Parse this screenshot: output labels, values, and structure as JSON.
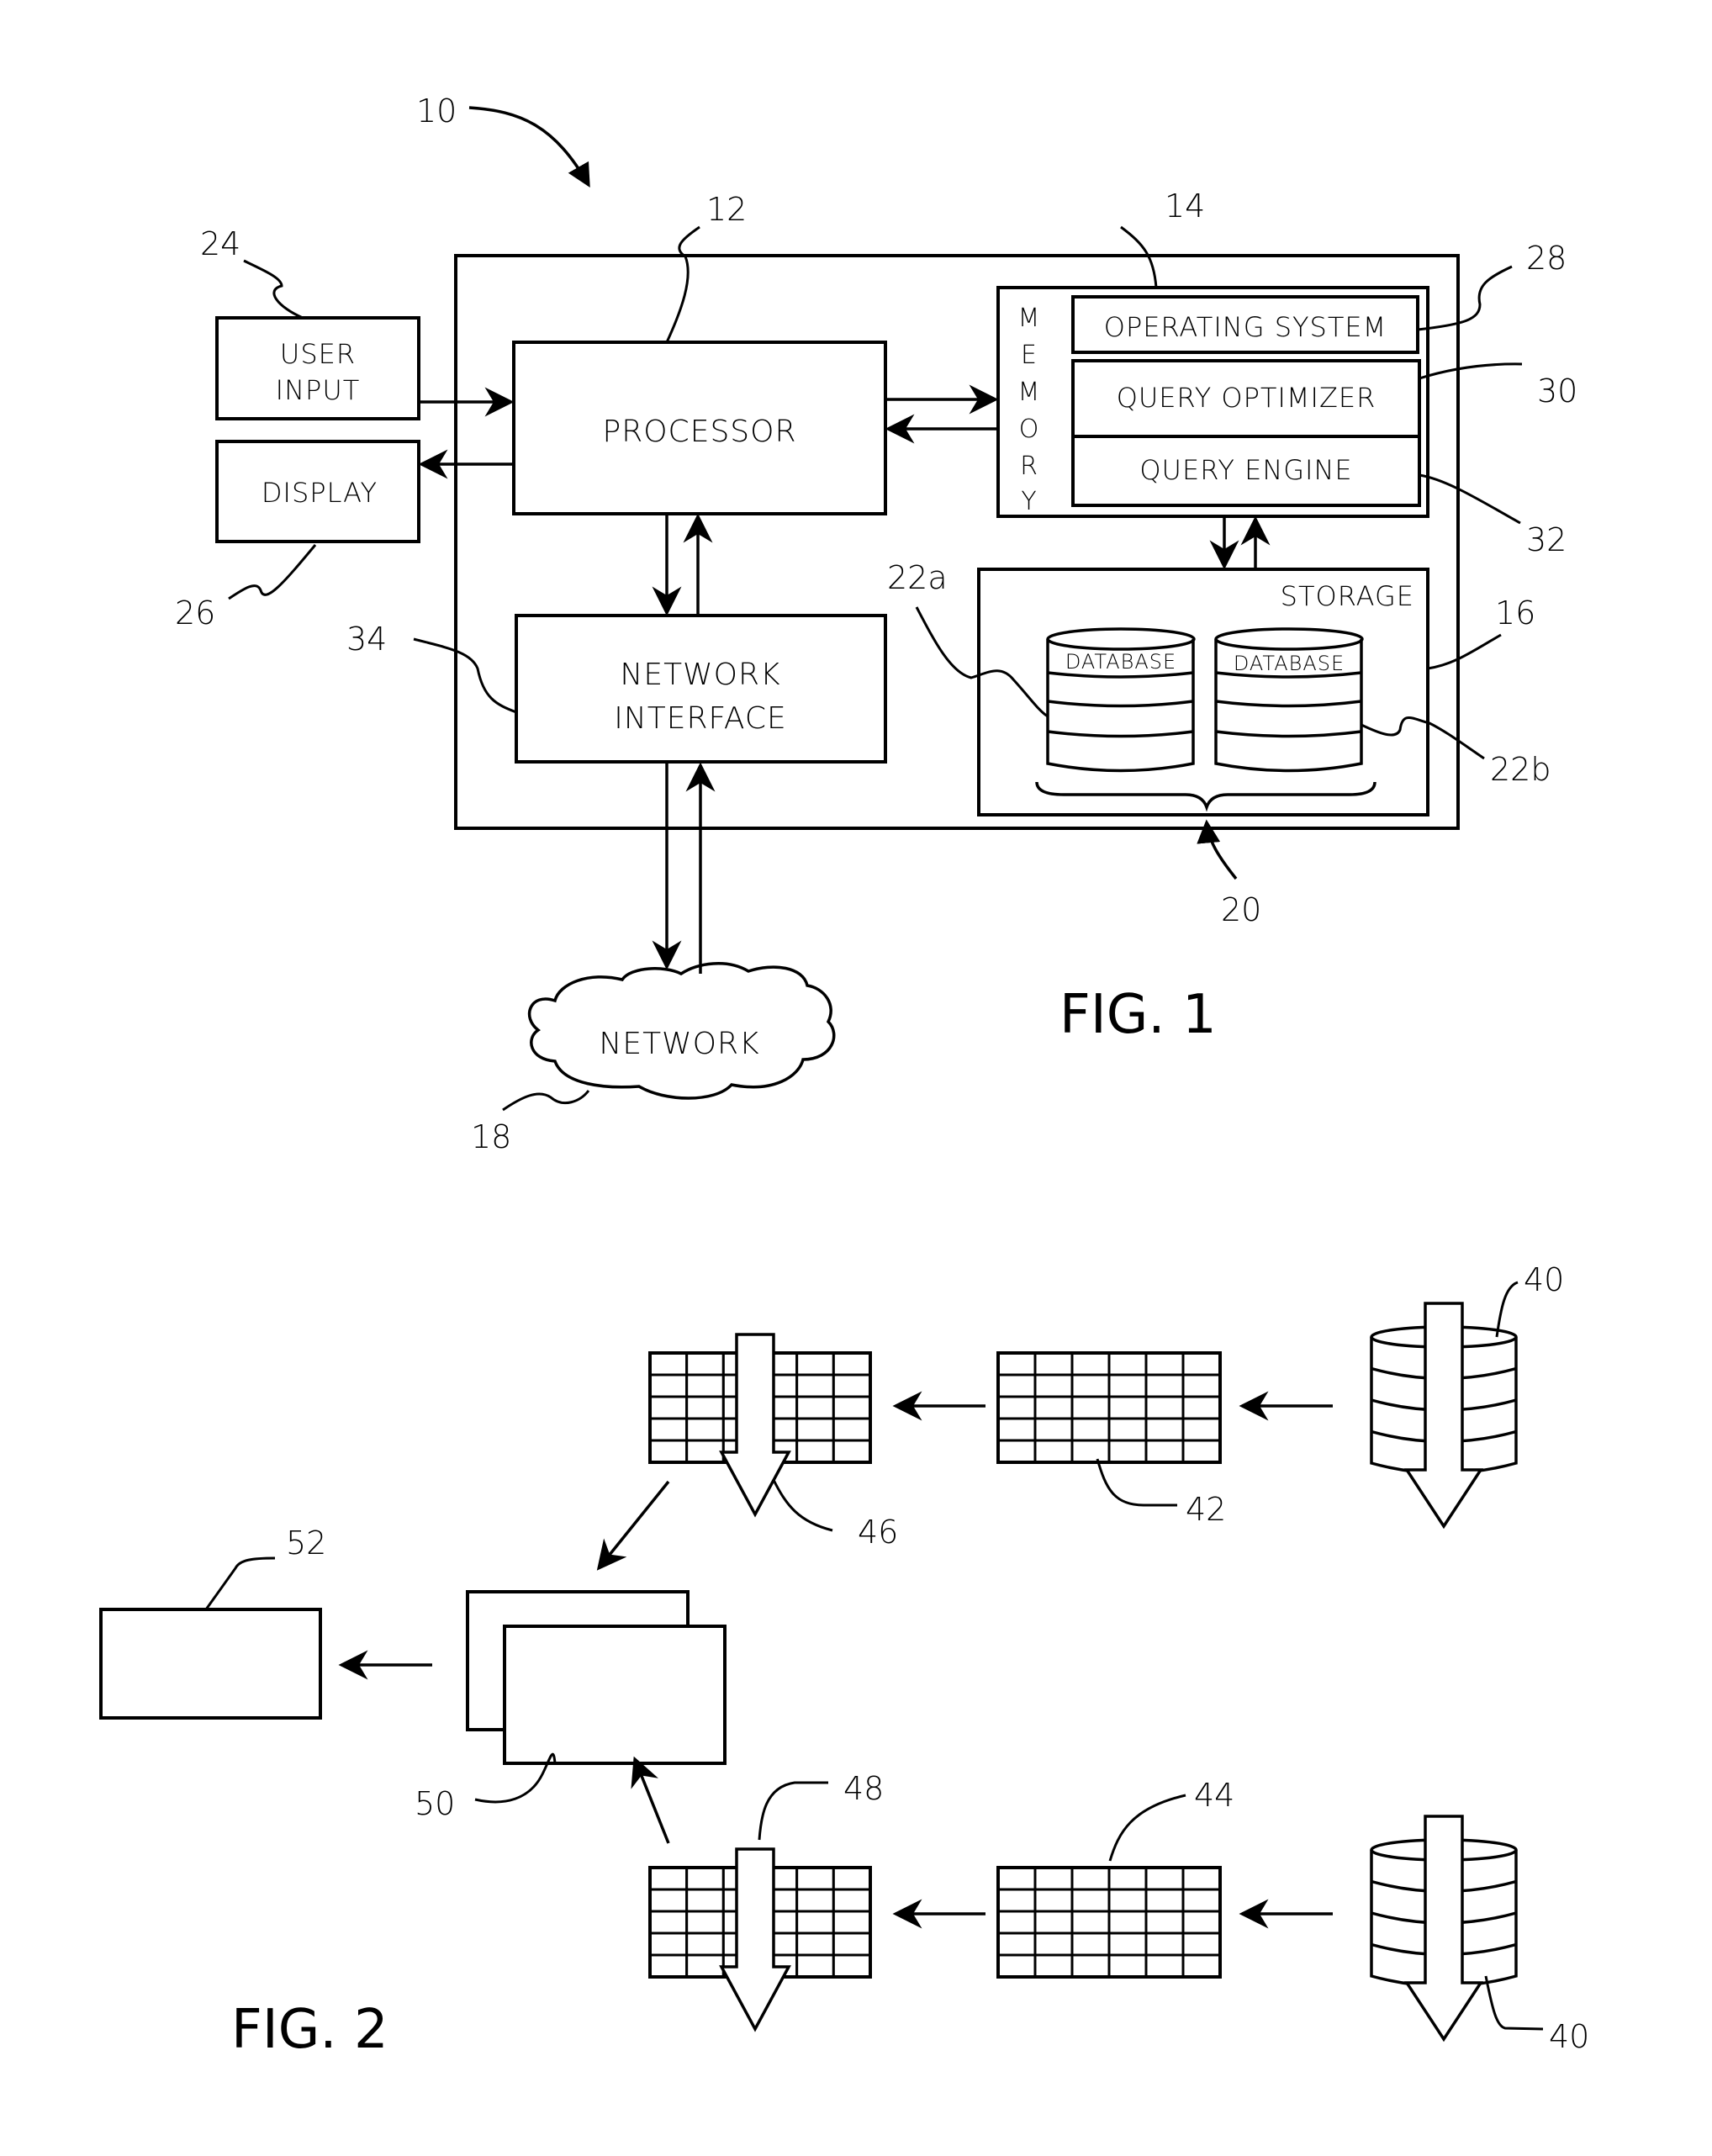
{
  "fig1": {
    "caption": "FIG. 1",
    "system_ref": "10",
    "processor": {
      "label": "PROCESSOR",
      "ref": "12"
    },
    "memory": {
      "label_letters": [
        "M",
        "E",
        "M",
        "O",
        "R",
        "Y"
      ],
      "ref": "14"
    },
    "operating_system": {
      "label": "OPERATING SYSTEM",
      "ref": "28"
    },
    "query_optimizer": {
      "label": "QUERY OPTIMIZER",
      "ref": "30"
    },
    "query_engine": {
      "label": "QUERY ENGINE",
      "ref": "32"
    },
    "storage": {
      "label": "STORAGE",
      "ref": "16"
    },
    "databases": [
      {
        "label": "DATABASE",
        "ref": "22a"
      },
      {
        "label": "DATABASE",
        "ref": "22b"
      }
    ],
    "database_group_ref": "20",
    "user_input": {
      "line1": "USER",
      "line2": "INPUT",
      "ref": "24"
    },
    "display": {
      "label": "DISPLAY",
      "ref": "26"
    },
    "network_interface": {
      "line1": "NETWORK",
      "line2": "INTERFACE",
      "ref": "34"
    },
    "network": {
      "label": "NETWORK",
      "ref": "18"
    }
  },
  "fig2": {
    "caption": "FIG. 2",
    "top_row": {
      "database_ref": "40",
      "table_ref": "42",
      "filtered_table_ref": "46"
    },
    "bottom_row": {
      "database_ref": "40",
      "table_ref": "44",
      "filtered_table_ref": "48"
    },
    "merge_ref": "50",
    "output_ref": "52",
    "grid": {
      "columns": 6,
      "rows": 5
    }
  }
}
